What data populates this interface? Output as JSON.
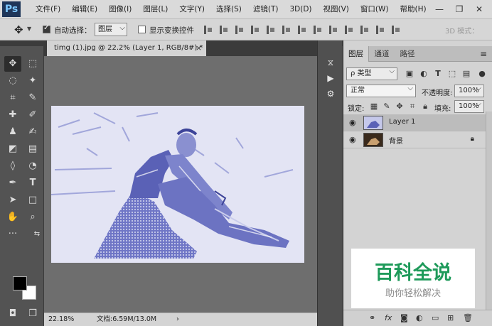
{
  "app": {
    "logo": "Ps",
    "menu": [
      "文件(F)",
      "编辑(E)",
      "图像(I)",
      "图层(L)",
      "文字(Y)",
      "选择(S)",
      "滤镜(T)",
      "3D(D)",
      "视图(V)",
      "窗口(W)",
      "帮助(H)"
    ]
  },
  "window_controls": {
    "minimize": "—",
    "restore": "❐",
    "close": "✕"
  },
  "options": {
    "auto_select_label": "自动选择：",
    "auto_select_checked": true,
    "auto_select_value": "图层",
    "show_transform_label": "显示变换控件",
    "show_transform_checked": false,
    "mode_3d_label": "3D 模式："
  },
  "document": {
    "tab_title": "timg (1).jpg @ 22.2% (Layer 1, RGB/8#) *",
    "tab_close": "×",
    "zoom": "22.18%",
    "doc_info": "文档:6.59M/13.0M",
    "status_arrow": "›"
  },
  "layers_panel": {
    "tabs": [
      "图层",
      "通道",
      "路径"
    ],
    "filter_kind": "ρ 类型",
    "blend_mode": "正常",
    "opacity_label": "不透明度:",
    "opacity_value": "100%",
    "lock_label": "锁定:",
    "fill_label": "填充:",
    "fill_value": "100%",
    "layers": [
      {
        "name": "Layer 1",
        "visible": true,
        "selected": true,
        "locked": false
      },
      {
        "name": "背景",
        "visible": true,
        "selected": false,
        "locked": true
      }
    ]
  },
  "watermark": {
    "title": "百科全说",
    "subtitle": "助你轻松解决"
  }
}
